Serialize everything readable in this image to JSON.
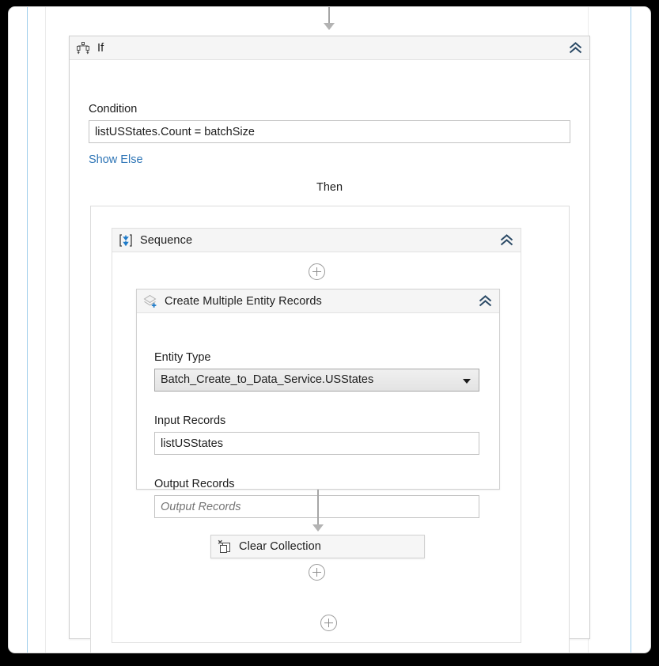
{
  "workflow": {
    "if_activity": {
      "title": "If",
      "icon": "if-branch-icon",
      "collapse_icon": "chevron-double-up-icon",
      "condition_label": "Condition",
      "condition_value": "listUSStates.Count = batchSize",
      "show_else_link": "Show Else",
      "then_label": "Then"
    },
    "sequence_activity": {
      "title": "Sequence",
      "icon": "sequence-icon",
      "collapse_icon": "chevron-double-up-icon",
      "add_button": "add-activity-plus-icon"
    },
    "create_records_activity": {
      "title": "Create Multiple Entity Records",
      "icon": "create-multiple-entity-records-icon",
      "collapse_icon": "chevron-double-up-icon",
      "fields": {
        "entity_type": {
          "label": "Entity Type",
          "value": "Batch_Create_to_Data_Service.USStates",
          "type": "dropdown"
        },
        "input_records": {
          "label": "Input Records",
          "value": "listUSStates",
          "placeholder": "Input Records",
          "type": "text"
        },
        "output_records": {
          "label": "Output Records",
          "value": "",
          "placeholder": "Output Records",
          "type": "text"
        }
      }
    },
    "clear_collection_activity": {
      "title": "Clear Collection",
      "icon": "clear-collection-icon"
    },
    "add_buttons": {
      "sequence_top": "add-activity-plus-icon",
      "sequence_bottom": "add-activity-plus-icon",
      "canvas_bottom": "add-activity-plus-icon"
    }
  },
  "colors": {
    "link": "#2e75b6",
    "accent_blue": "#1e7ac8",
    "header_bg": "#f5f5f5",
    "border": "#d0d0d0",
    "rail_blue": "#9ecdeb",
    "arrow_grey": "#a6a6a6"
  }
}
